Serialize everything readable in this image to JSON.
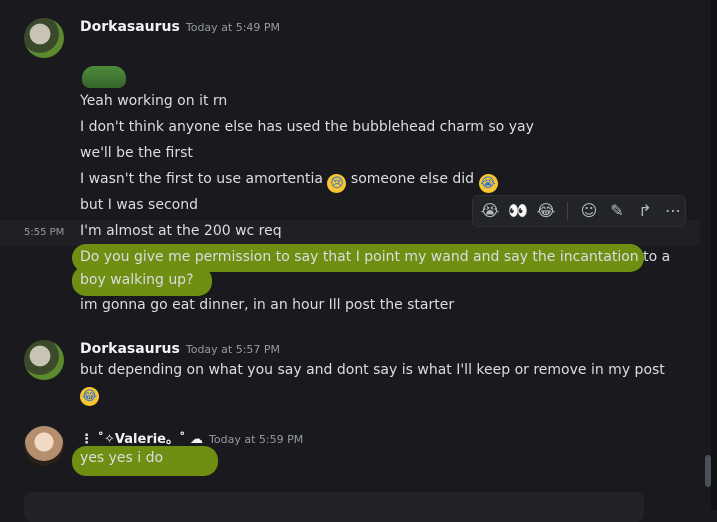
{
  "messages": [
    {
      "author": "Dorkasaurus",
      "timestamp": "Today at 5:49 PM",
      "lines": [
        "Yeah working on it rn",
        "I don't think anyone else has used the bubblehead charm so yay",
        "we'll be the first",
        "I wasn't the first to use amortentia",
        "someone else did",
        "but I was second",
        "I'm almost at the 200 wc req",
        "Do you give me permission to say that I point my wand and say the incantation to a",
        "boy walking up?",
        "im gonna go eat dinner, in an hour Ill post the starter"
      ],
      "side_timestamp": "5:55 PM"
    },
    {
      "author": "Dorkasaurus",
      "timestamp": "Today at 5:57 PM",
      "lines": [
        "but depending on what you say and dont say is what I'll keep or remove in my post"
      ]
    },
    {
      "author": "⋮ ˚✧Valerie。˚ ☁",
      "timestamp": "Today at 5:59 PM",
      "lines": [
        "yes yes i do"
      ]
    }
  ],
  "toolbar": {
    "reactions": [
      "😭",
      "👀",
      "😂"
    ],
    "icons": [
      "add-reaction-icon",
      "edit-icon",
      "forward-icon",
      "more-icon"
    ]
  },
  "colors": {
    "background": "#1a1a1e",
    "highlight": "#6e8f12",
    "username": "#f2f3f5",
    "timestamp": "#949ba4"
  }
}
